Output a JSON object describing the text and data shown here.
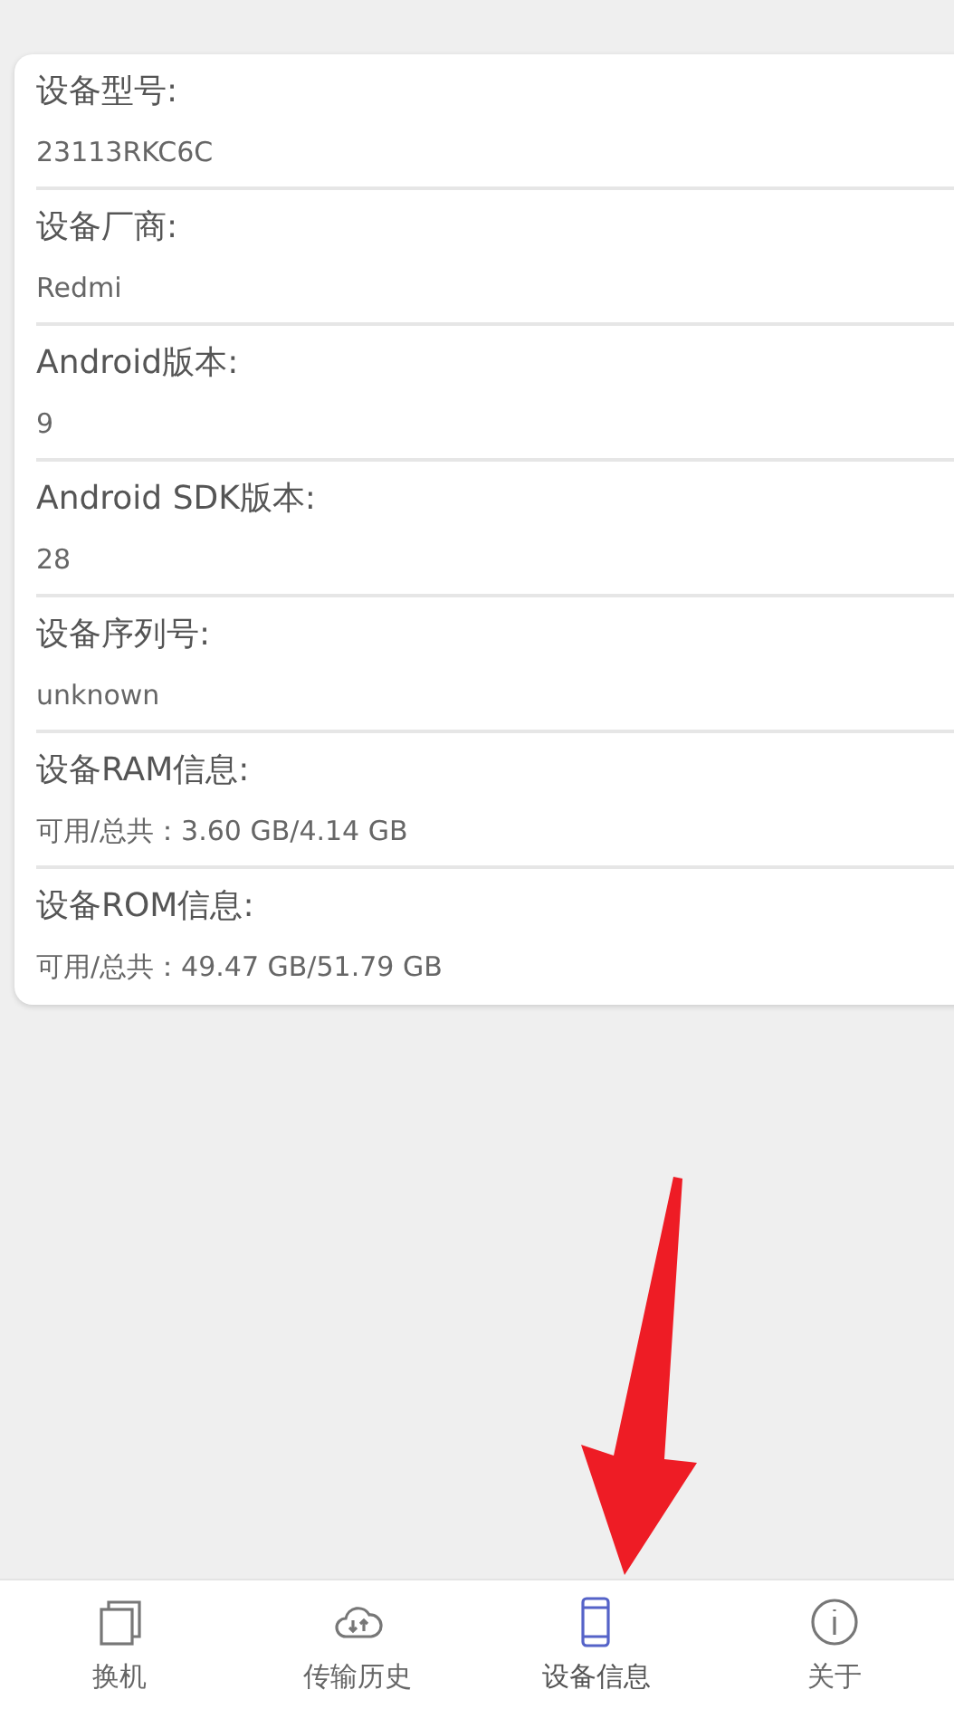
{
  "device_info": [
    {
      "label": "设备型号:",
      "value": "23113RKC6C"
    },
    {
      "label": "设备厂商:",
      "value": "Redmi"
    },
    {
      "label": "Android版本:",
      "value": "9"
    },
    {
      "label": "Android SDK版本:",
      "value": "28"
    },
    {
      "label": "设备序列号:",
      "value": "unknown"
    },
    {
      "label": "设备RAM信息:",
      "value": "可用/总共：3.60 GB/4.14 GB"
    },
    {
      "label": "设备ROM信息:",
      "value": "可用/总共：49.47 GB/51.79 GB"
    }
  ],
  "annotation": {
    "kind": "arrow"
  },
  "bottom_nav": [
    {
      "label": "换机",
      "kind": "copy",
      "selected": false
    },
    {
      "label": "传输历史",
      "kind": "cloud",
      "selected": false
    },
    {
      "label": "设备信息",
      "kind": "phone",
      "selected": true
    },
    {
      "label": "关于",
      "kind": "info",
      "selected": false
    }
  ]
}
